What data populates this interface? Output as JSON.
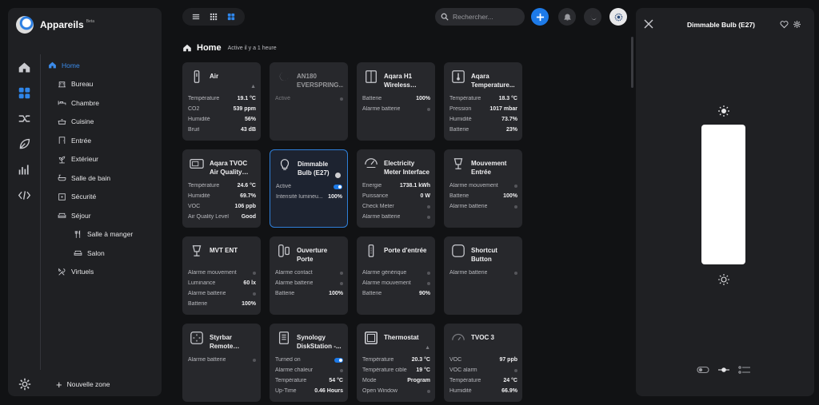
{
  "app": {
    "title": "Appareils",
    "badge": "Beta"
  },
  "sidebar": {
    "items": [
      {
        "label": "Home",
        "level": 0,
        "icon": "home-icon",
        "active": true
      },
      {
        "label": "Bureau",
        "level": 1,
        "icon": "office-icon"
      },
      {
        "label": "Chambre",
        "level": 1,
        "icon": "bed-icon"
      },
      {
        "label": "Cuisine",
        "level": 1,
        "icon": "pot-icon"
      },
      {
        "label": "Entrée",
        "level": 1,
        "icon": "door-icon"
      },
      {
        "label": "Extérieur",
        "level": 1,
        "icon": "plant-icon"
      },
      {
        "label": "Salle de bain",
        "level": 1,
        "icon": "bath-icon"
      },
      {
        "label": "Sécurité",
        "level": 1,
        "icon": "safe-icon"
      },
      {
        "label": "Séjour",
        "level": 1,
        "icon": "sofa-icon"
      },
      {
        "label": "Salle à manger",
        "level": 2,
        "icon": "cutlery-icon"
      },
      {
        "label": "Salon",
        "level": 2,
        "icon": "sofa-icon"
      },
      {
        "label": "Virtuels",
        "level": 1,
        "icon": "tools-icon"
      }
    ],
    "new_zone": "Nouvelle zone"
  },
  "search": {
    "placeholder": "Rechercher..."
  },
  "page": {
    "title": "Home",
    "subtitle": "Active il y a 1 heure"
  },
  "cards": [
    {
      "title": "Air",
      "icon": "air-sensor-icon",
      "warn": true,
      "rows": [
        [
          "Température",
          "19.1 °C"
        ],
        [
          "CO2",
          "539 ppm"
        ],
        [
          "Humidité",
          "56%"
        ],
        [
          "Bruit",
          "43 dB"
        ]
      ]
    },
    {
      "title": "AN180 EVERSPRING...",
      "icon": "moon-icon",
      "dim": true,
      "rows": [
        [
          "Activé",
          "dot"
        ]
      ]
    },
    {
      "title": "Aqara H1 Wireless Switc...",
      "icon": "switch-icon",
      "rows": [
        [
          "Batterie",
          "100%"
        ],
        [
          "Alarme batterie",
          "dot"
        ]
      ]
    },
    {
      "title": "Aqara Temperature...",
      "icon": "thermo-icon",
      "rows": [
        [
          "Température",
          "18.3 °C"
        ],
        [
          "Pression",
          "1017 mbar"
        ],
        [
          "Humidité",
          "73.7%"
        ],
        [
          "Batterie",
          "23%"
        ]
      ]
    },
    {
      "title": "Aqara TVOC Air Quality Monitor",
      "icon": "monitor-icon",
      "rows": [
        [
          "Température",
          "24.6 °C"
        ],
        [
          "Humidité",
          "69.7%"
        ],
        [
          "VOC",
          "106 ppb"
        ],
        [
          "Air Quality Level",
          "Good"
        ]
      ]
    },
    {
      "title": "Dimmable Bulb (E27)",
      "icon": "bulb-icon",
      "sel": true,
      "bulbdot": true,
      "rows": [
        [
          "Activé",
          "toggle"
        ],
        [
          "Intensité lumineu...",
          "100%"
        ]
      ]
    },
    {
      "title": "Electricity Meter Interface",
      "icon": "meter-icon",
      "rows": [
        [
          "Énergie",
          "1738.1 kWh"
        ],
        [
          "Puissance",
          "0 W"
        ],
        [
          "Check Meter",
          "dot"
        ],
        [
          "Alarme batterie",
          "dot"
        ]
      ]
    },
    {
      "title": "Mouvement Entrée",
      "icon": "motion-icon",
      "rows": [
        [
          "Alarme mouvement",
          "dot"
        ],
        [
          "Batterie",
          "100%"
        ],
        [
          "Alarme batterie",
          "dot"
        ]
      ]
    },
    {
      "title": "MVT ENT",
      "icon": "motion-icon",
      "rows": [
        [
          "Alarme mouvement",
          "dot"
        ],
        [
          "Luminance",
          "60 lx"
        ],
        [
          "Alarme batterie",
          "dot"
        ],
        [
          "Batterie",
          "100%"
        ]
      ]
    },
    {
      "title": "Ouverture Porte",
      "icon": "contact-icon",
      "rows": [
        [
          "Alarme contact",
          "dot"
        ],
        [
          "Alarme batterie",
          "dot"
        ],
        [
          "Batterie",
          "100%"
        ]
      ]
    },
    {
      "title": "Porte d'entrée",
      "icon": "door-sensor-icon",
      "rows": [
        [
          "Alarme générique",
          "dot"
        ],
        [
          "Alarme mouvement",
          "dot"
        ],
        [
          "Batterie",
          "90%"
        ]
      ]
    },
    {
      "title": "Shortcut Button",
      "icon": "button-icon",
      "rows": [
        [
          "Alarme batterie",
          "dot"
        ]
      ]
    },
    {
      "title": "Styrbar Remote Control",
      "icon": "remote-icon",
      "rows": [
        [
          "Alarme batterie",
          "dot"
        ]
      ]
    },
    {
      "title": "Synology DiskStation -...",
      "icon": "nas-icon",
      "rows": [
        [
          "Turned on",
          "toggle"
        ],
        [
          "Alarme chaleur",
          "dot"
        ],
        [
          "Température",
          "54 °C"
        ],
        [
          "Up-Time",
          "0.46 Hours"
        ]
      ]
    },
    {
      "title": "Thermostat",
      "icon": "thermostat-icon",
      "warn": true,
      "rows": [
        [
          "Température",
          "20.3 °C"
        ],
        [
          "Température cible",
          "19 °C"
        ],
        [
          "Mode",
          "Program"
        ],
        [
          "Open Window",
          "dot"
        ]
      ]
    },
    {
      "title": "TVOC 3",
      "icon": "gauge-icon",
      "rows": [
        [
          "VOC",
          "97 ppb"
        ],
        [
          "VOC alarm",
          "dot"
        ],
        [
          "Température",
          "24 °C"
        ],
        [
          "Humidité",
          "66.9%"
        ]
      ]
    }
  ],
  "panel": {
    "title": "Dimmable Bulb (E27)",
    "brightness_fraction": 1.0
  },
  "colors": {
    "accent": "#1d7ae8",
    "bg": "#111214",
    "surface": "#1f2023",
    "card": "#27282c"
  }
}
